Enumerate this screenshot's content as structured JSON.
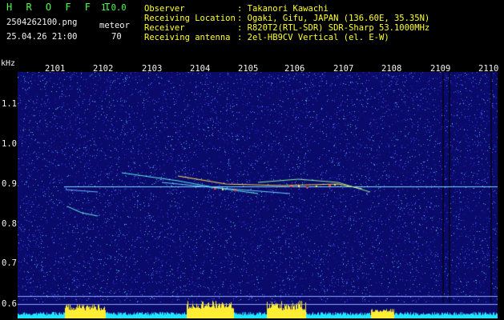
{
  "app": {
    "name": "H R O F F T",
    "version": "1.0.0"
  },
  "file": {
    "name": "2504262100.png",
    "datetime": "25.04.26 21:00"
  },
  "detection": {
    "label": "meteor",
    "count": "70"
  },
  "info": {
    "rows": [
      {
        "label": "Observer",
        "value": ": Takanori Kawachi"
      },
      {
        "label": "Receiving Location",
        "value": ": Ogaki, Gifu, JAPAN (136.60E, 35.35N)"
      },
      {
        "label": "Receiver",
        "value": ": R820T2(RTL-SDR) SDR-Sharp 53.1000MHz"
      },
      {
        "label": "Receiving antenna",
        "value": ": 2el-HB9CV Vertical (el. E-W)"
      }
    ]
  },
  "axis": {
    "unit": "kHz",
    "time_ticks": [
      "2101",
      "2102",
      "2103",
      "2104",
      "2105",
      "2106",
      "2107",
      "2108",
      "2109",
      "2110"
    ],
    "freq_ticks": [
      "1.1",
      "1.0",
      "0.9",
      "0.8",
      "0.7",
      "0.6"
    ]
  },
  "colors": {
    "background": "#000000",
    "noise_dark": "#0a0a6a",
    "noise_light": "#3a3ad8",
    "header_green": "#4cff4c",
    "header_white": "#f2f2f2",
    "header_yellow": "#ffff33",
    "trace": "#ffd84a",
    "hot": "#ff3a2a",
    "carrier": "#7fd8ff",
    "histogram_yellow": "#ffee33",
    "histogram_cyan": "#22e6ff"
  }
}
